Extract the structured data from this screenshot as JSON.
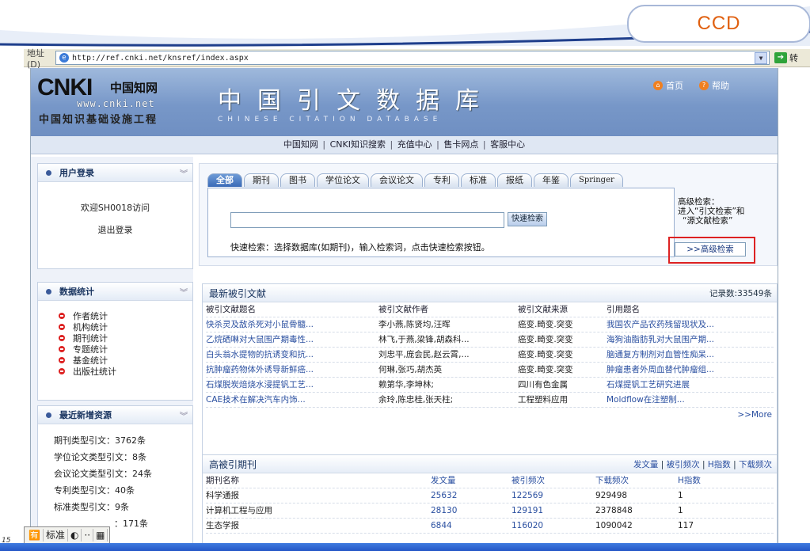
{
  "slide": {
    "badge": "CCD",
    "page_number": "15"
  },
  "browser": {
    "address_label": "地址(D)",
    "url": "http://ref.cnki.net/knsref/index.aspx",
    "go_label": "转"
  },
  "header": {
    "logo_text": "CNKI",
    "logo_cn": "中国知网",
    "logo_url": "www.cnki.net",
    "logo_subtitle": "中国知识基础设施工程",
    "title": "中国引文数据库",
    "subtitle": "CHINESE   CITATION   DATABASE",
    "home_label": "首页",
    "help_label": "帮助"
  },
  "nav": {
    "items": [
      "中国知网",
      "CNKI知识搜索",
      "充值中心",
      "售卡网点",
      "客服中心"
    ]
  },
  "login": {
    "title": "用户登录",
    "welcome": "欢迎SH0018访问",
    "logout": "退出登录"
  },
  "stats": {
    "title": "数据统计",
    "items": [
      "作者统计",
      "机构统计",
      "期刊统计",
      "专题统计",
      "基金统计",
      "出版社统计"
    ]
  },
  "new_resources": {
    "title": "最近新增资源",
    "items": [
      "期刊类型引文：3762条",
      "学位论文类型引文：8条",
      "会议论文类型引文：24条",
      "专利类型引文：40条",
      "标准类型引文：9条",
      "：171条"
    ]
  },
  "search": {
    "tabs": [
      "全部",
      "期刊",
      "图书",
      "学位论文",
      "会议论文",
      "专利",
      "标准",
      "报纸",
      "年鉴",
      "Springer"
    ],
    "quick_button": "快速检索",
    "hint": "快速检索：选择数据库(如期刊)，输入检索词，点击快速检索按钮。",
    "advanced_desc_1": "高级检索：",
    "advanced_desc_2": "进入“引文检索”和",
    "advanced_desc_3": "“源文献检索”",
    "advanced_button": ">>高级检索"
  },
  "recent": {
    "title": "最新被引文献",
    "record_count": "记录数:33549条",
    "columns": [
      "被引文献题名",
      "被引文献作者",
      "被引文献来源",
      "引用题名"
    ],
    "rows": [
      [
        "快杀灵及敌杀死对小鼠骨髓...",
        "李小燕,陈贤均,汪晖",
        "癌变.畸变.突变",
        "我国农产品农药残留现状及..."
      ],
      [
        "乙烷硒啉对大鼠围产期毒性...",
        "林飞,于燕,梁锋,胡森科...",
        "癌变.畸变.突变",
        "海狗油脂肪乳对大鼠围产期..."
      ],
      [
        "白头翁水提物的抗诱变和抗...",
        "刘忠平,庞会民,赵云霄,...",
        "癌变.畸变.突变",
        "脑通复方制剂对血管性痴呆..."
      ],
      [
        "抗肿瘤药物体外诱导新鲜癌...",
        "何琳,张巧,胡杰英",
        "癌变.畸变.突变",
        "肿瘤患者外周血替代肿瘤组..."
      ],
      [
        "石煤脱炭焙烧水浸提钒工艺...",
        "赖第华,李坤林;",
        "四川有色金属",
        "石煤提钒工艺研究进展"
      ],
      [
        "CAE技术在解决汽车内饰...",
        "余玲,陈忠桂,张天柱;",
        "工程塑料应用",
        "Moldflow在注塑制..."
      ]
    ],
    "more": ">>More"
  },
  "top_journals": {
    "title": "高被引期刊",
    "links": [
      "发文量",
      "被引频次",
      "H指数",
      "下载频次"
    ],
    "columns": [
      "期刊名称",
      "发文量",
      "被引频次",
      "下载频次",
      "H指数"
    ],
    "rows": [
      [
        "科学通报",
        "25632",
        "122569",
        "929498",
        "1"
      ],
      [
        "计算机工程与应用",
        "28130",
        "129191",
        "2378848",
        "1"
      ],
      [
        "生态学报",
        "6844",
        "116020",
        "1090042",
        "117"
      ]
    ]
  },
  "ime": {
    "label": "标准"
  }
}
